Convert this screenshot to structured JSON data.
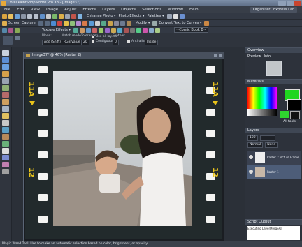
{
  "window": {
    "title": "Corel PaintShop Photo Pro X3 - [Image37]",
    "logo_icon": "paintshop-logo-icon"
  },
  "menu": [
    "File",
    "Edit",
    "View",
    "Image",
    "Adjust",
    "Effects",
    "Layers",
    "Objects",
    "Selections",
    "Window",
    "Help"
  ],
  "workspaces": [
    "Organizer",
    "Express Lab"
  ],
  "toolbar1": {
    "enhance_photo": "Enhance Photo ▾",
    "photo_effects": "Photo Effects ▾",
    "palettes": "Palettes ▾",
    "modify": "Modify ▾",
    "convert_curves": "Convert Text to Curves ▾",
    "screen_capture": "Screen Capture"
  },
  "toolbar2": {
    "texture_effects": "Texture Effects ▾",
    "preset": "~Comic Book B~"
  },
  "tool_options": {
    "mode_label": "Mode:",
    "mode_value": "Add (Shift)",
    "match_mode_label": "Match mode:",
    "match_mode_value": "RGB Value",
    "tolerance_label": "Tolerance:",
    "tolerance_value": "20",
    "use_all_layers": "Use all layers",
    "contiguous": "Contiguous",
    "feather_label": "Feather:",
    "feather_value": "0",
    "antialias": "Anti-alias",
    "inside_value": "Inside"
  },
  "document": {
    "title": "Image37* @ 46% (Raster 2)"
  },
  "film": {
    "frame_label": "11A",
    "frame_number": "12",
    "colors": {
      "frame": "#222a2c",
      "edge_text": "#e8c21a",
      "holes": "#f4f4f2"
    }
  },
  "panels": {
    "overview": {
      "title": "Overview",
      "tabs": [
        "Preview",
        "Info"
      ]
    },
    "materials": {
      "title": "Materials",
      "all_tools": "All tools"
    },
    "layers": {
      "title": "Layers",
      "opacity": "100",
      "blend": "Normal",
      "none": "None",
      "items": [
        "Raster 2 Picture Frame",
        "Raster 1"
      ]
    },
    "script_output": {
      "title": "Script Output",
      "text": "Executing LayerMergeAll"
    }
  },
  "status": {
    "text": "Magic Wand Tool: Use to make an automatic selection based on color, brightness, or opacity"
  }
}
